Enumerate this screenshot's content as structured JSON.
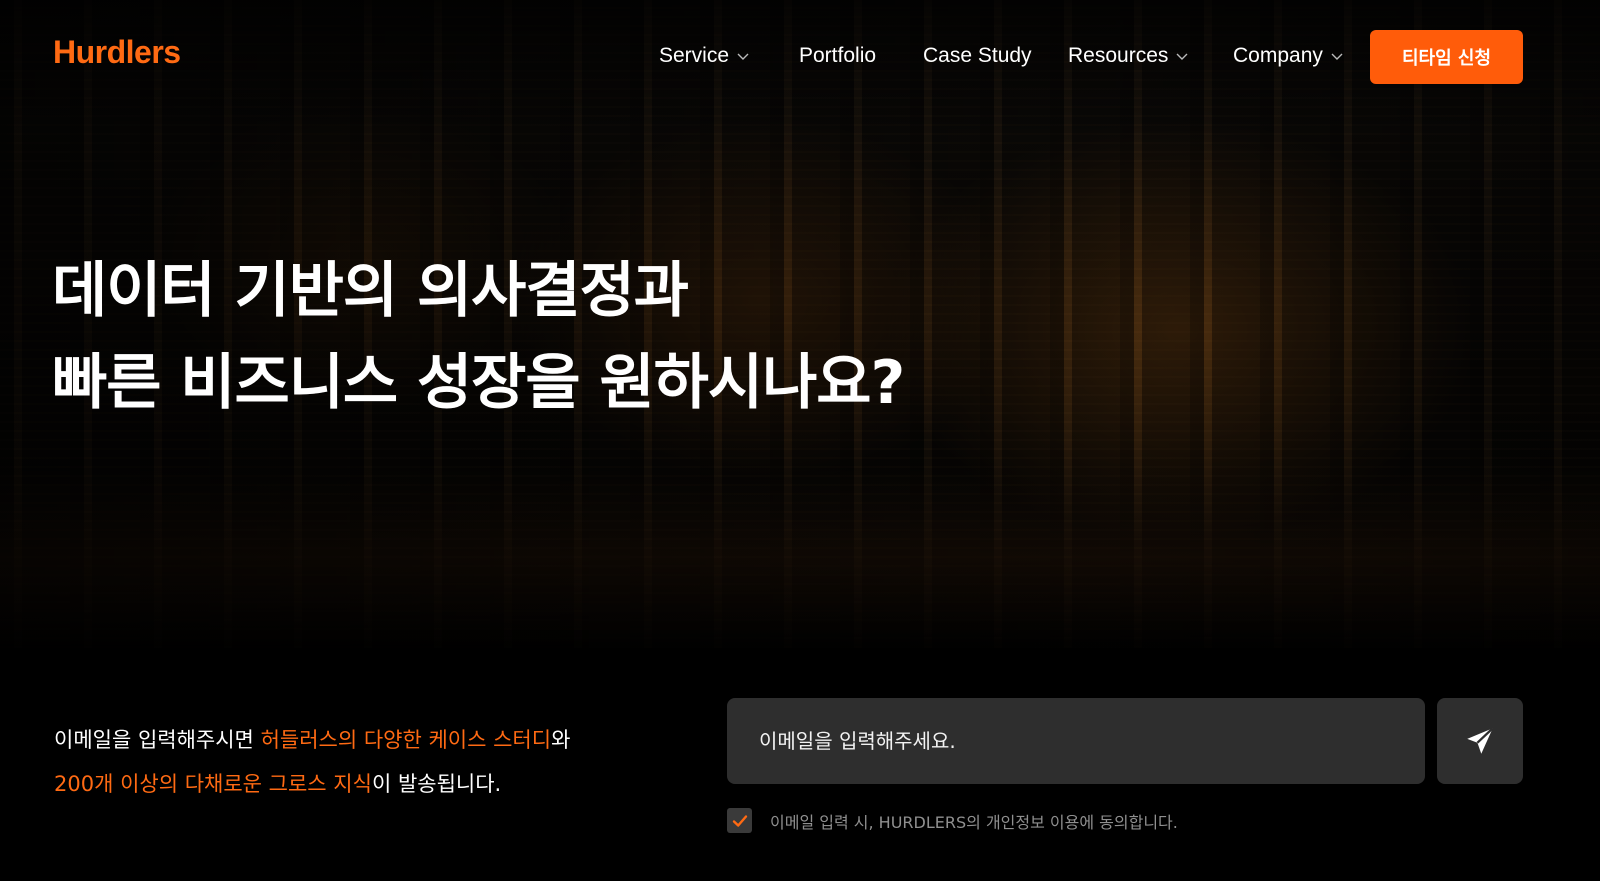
{
  "brand": {
    "logo_text": "Hurdlers",
    "accent_color": "#ff6a13",
    "cta_color": "#ff5c0a"
  },
  "nav": {
    "items": [
      {
        "label": "Service",
        "has_dropdown": true,
        "icon": "chevron-down-icon"
      },
      {
        "label": "Portfolio",
        "has_dropdown": false
      },
      {
        "label": "Case Study",
        "has_dropdown": false
      },
      {
        "label": "Resources",
        "has_dropdown": true,
        "icon": "chevron-down-icon"
      },
      {
        "label": "Company",
        "has_dropdown": true,
        "icon": "chevron-down-icon"
      }
    ],
    "cta_label": "티타임 신청"
  },
  "hero": {
    "headline_line1": "데이터 기반의 의사결정과",
    "headline_line2": "빠른 비즈니스 성장을 원하시나요?"
  },
  "signup": {
    "promo_line1_prefix": "이메일을 입력해주시면 ",
    "promo_line1_accent": "허들러스의 다양한 케이스 스터디",
    "promo_line1_suffix": "와",
    "promo_line2_accent": "200개 이상의 다채로운 그로스 지식",
    "promo_line2_suffix": "이 발송됩니다.",
    "email_placeholder": "이메일을 입력해주세요.",
    "send_icon": "paper-plane-icon",
    "consent_checked": true,
    "consent_text": "이메일 입력 시, HURDLERS의 개인정보 이용에 동의합니다."
  }
}
